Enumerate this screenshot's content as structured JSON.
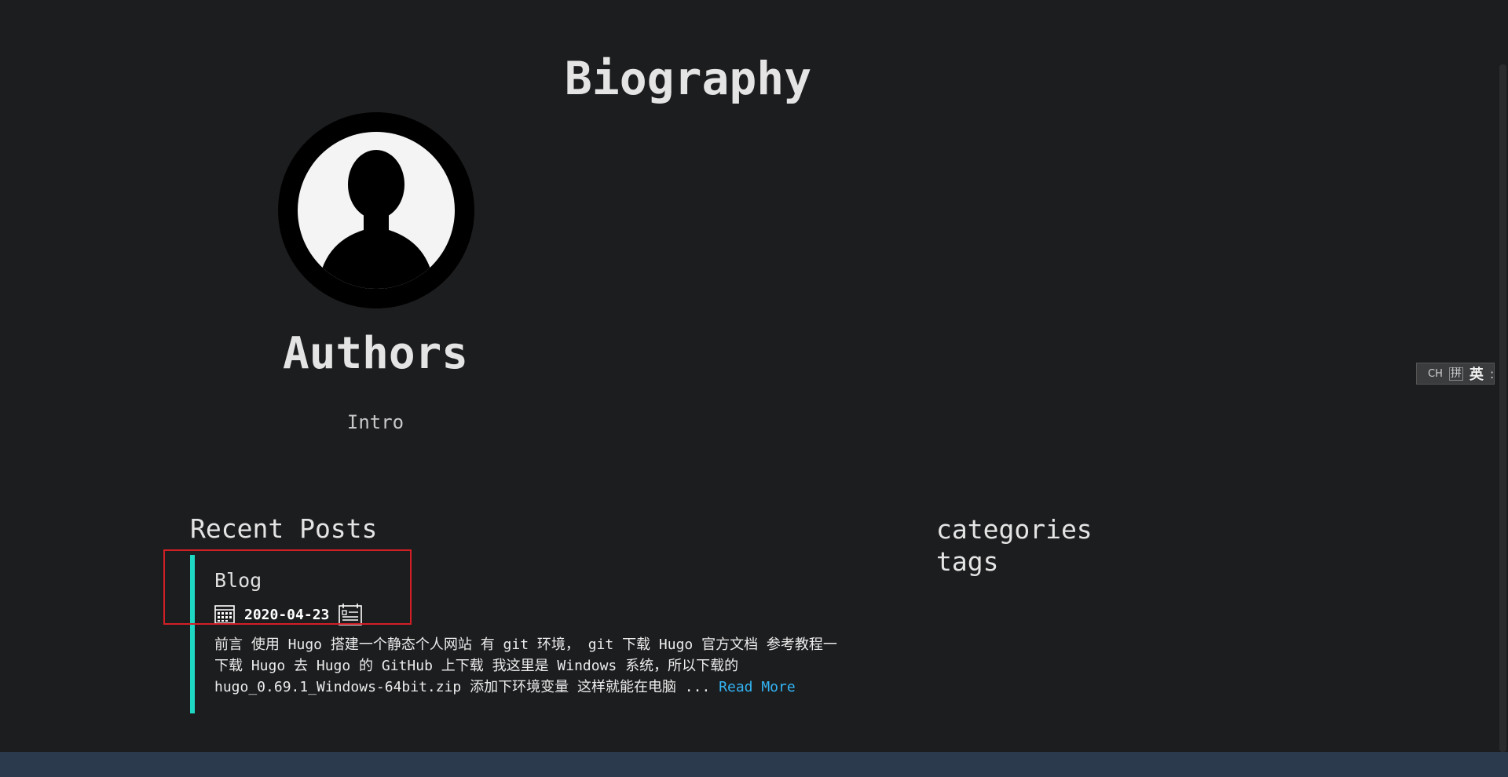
{
  "page": {
    "title": "Biography"
  },
  "profile": {
    "name": "Authors",
    "intro": "Intro"
  },
  "recent_posts": {
    "heading": "Recent Posts",
    "posts": [
      {
        "title": "Blog",
        "date": "2020-04-23",
        "summary_lines": [
          "前言 使用 Hugo 搭建一个静态个人网站 有 git 环境， git 下载 Hugo 官方文档 参考教程一",
          "下载 Hugo 去 Hugo 的 GitHub 上下载 我这里是 Windows 系统，所以下载的",
          "hugo_0.69.1_Windows-64bit.zip 添加下环境变量 这样就能在电脑 ... "
        ],
        "read_more": "Read More"
      }
    ]
  },
  "sidebar": {
    "links": [
      "categories",
      "tags"
    ]
  },
  "ime": {
    "ch": "CH",
    "pinyin": "拼",
    "lang": "英",
    "menu": ":"
  },
  "colors": {
    "background": "#1c1d1f",
    "accent_border": "#1fd8c3",
    "link": "#33b5f5",
    "highlight": "#d21f26",
    "footer": "#2c3a4d"
  },
  "icons": {
    "avatar": "user-silhouette-icon",
    "date": "calendar-icon",
    "reading": "list-icon"
  }
}
